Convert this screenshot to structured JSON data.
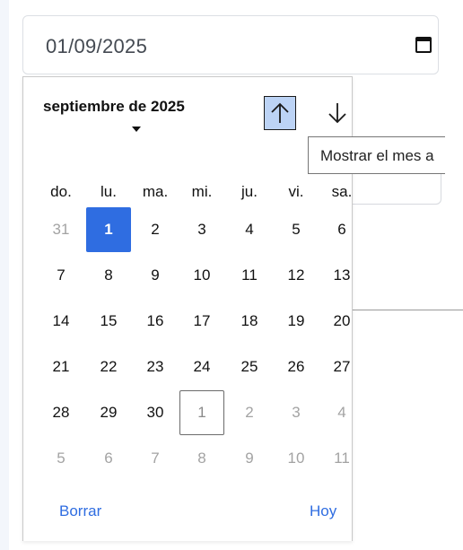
{
  "date_input": {
    "value": "01/09/2025",
    "icon": "calendar-icon"
  },
  "picker": {
    "month_label": "septiembre de 2025",
    "prev_month_icon": "arrow-up-icon",
    "next_month_icon": "arrow-down-icon",
    "tooltip": "Mostrar el mes a",
    "weekdays": [
      "do.",
      "lu.",
      "ma.",
      "mi.",
      "ju.",
      "vi.",
      "sa."
    ],
    "weeks": [
      [
        {
          "label": "31",
          "muted": true
        },
        {
          "label": "1",
          "selected": true
        },
        {
          "label": "2"
        },
        {
          "label": "3"
        },
        {
          "label": "4"
        },
        {
          "label": "5"
        },
        {
          "label": "6"
        }
      ],
      [
        {
          "label": "7"
        },
        {
          "label": "8"
        },
        {
          "label": "9"
        },
        {
          "label": "10"
        },
        {
          "label": "11"
        },
        {
          "label": "12"
        },
        {
          "label": "13"
        }
      ],
      [
        {
          "label": "14"
        },
        {
          "label": "15"
        },
        {
          "label": "16"
        },
        {
          "label": "17"
        },
        {
          "label": "18"
        },
        {
          "label": "19"
        },
        {
          "label": "20"
        }
      ],
      [
        {
          "label": "21"
        },
        {
          "label": "22"
        },
        {
          "label": "23"
        },
        {
          "label": "24"
        },
        {
          "label": "25"
        },
        {
          "label": "26"
        },
        {
          "label": "27"
        }
      ],
      [
        {
          "label": "28"
        },
        {
          "label": "29"
        },
        {
          "label": "30"
        },
        {
          "label": "1",
          "muted": true,
          "focused": true
        },
        {
          "label": "2",
          "muted": true
        },
        {
          "label": "3",
          "muted": true
        },
        {
          "label": "4",
          "muted": true
        }
      ],
      [
        {
          "label": "5",
          "muted": true
        },
        {
          "label": "6",
          "muted": true
        },
        {
          "label": "7",
          "muted": true
        },
        {
          "label": "8",
          "muted": true
        },
        {
          "label": "9",
          "muted": true
        },
        {
          "label": "10",
          "muted": true
        },
        {
          "label": "11",
          "muted": true
        }
      ]
    ],
    "clear_label": "Borrar",
    "today_label": "Hoy"
  },
  "colors": {
    "accent": "#2f6de1",
    "nav_highlight": "#bcd3f5",
    "muted_text": "#a3a3a3"
  }
}
